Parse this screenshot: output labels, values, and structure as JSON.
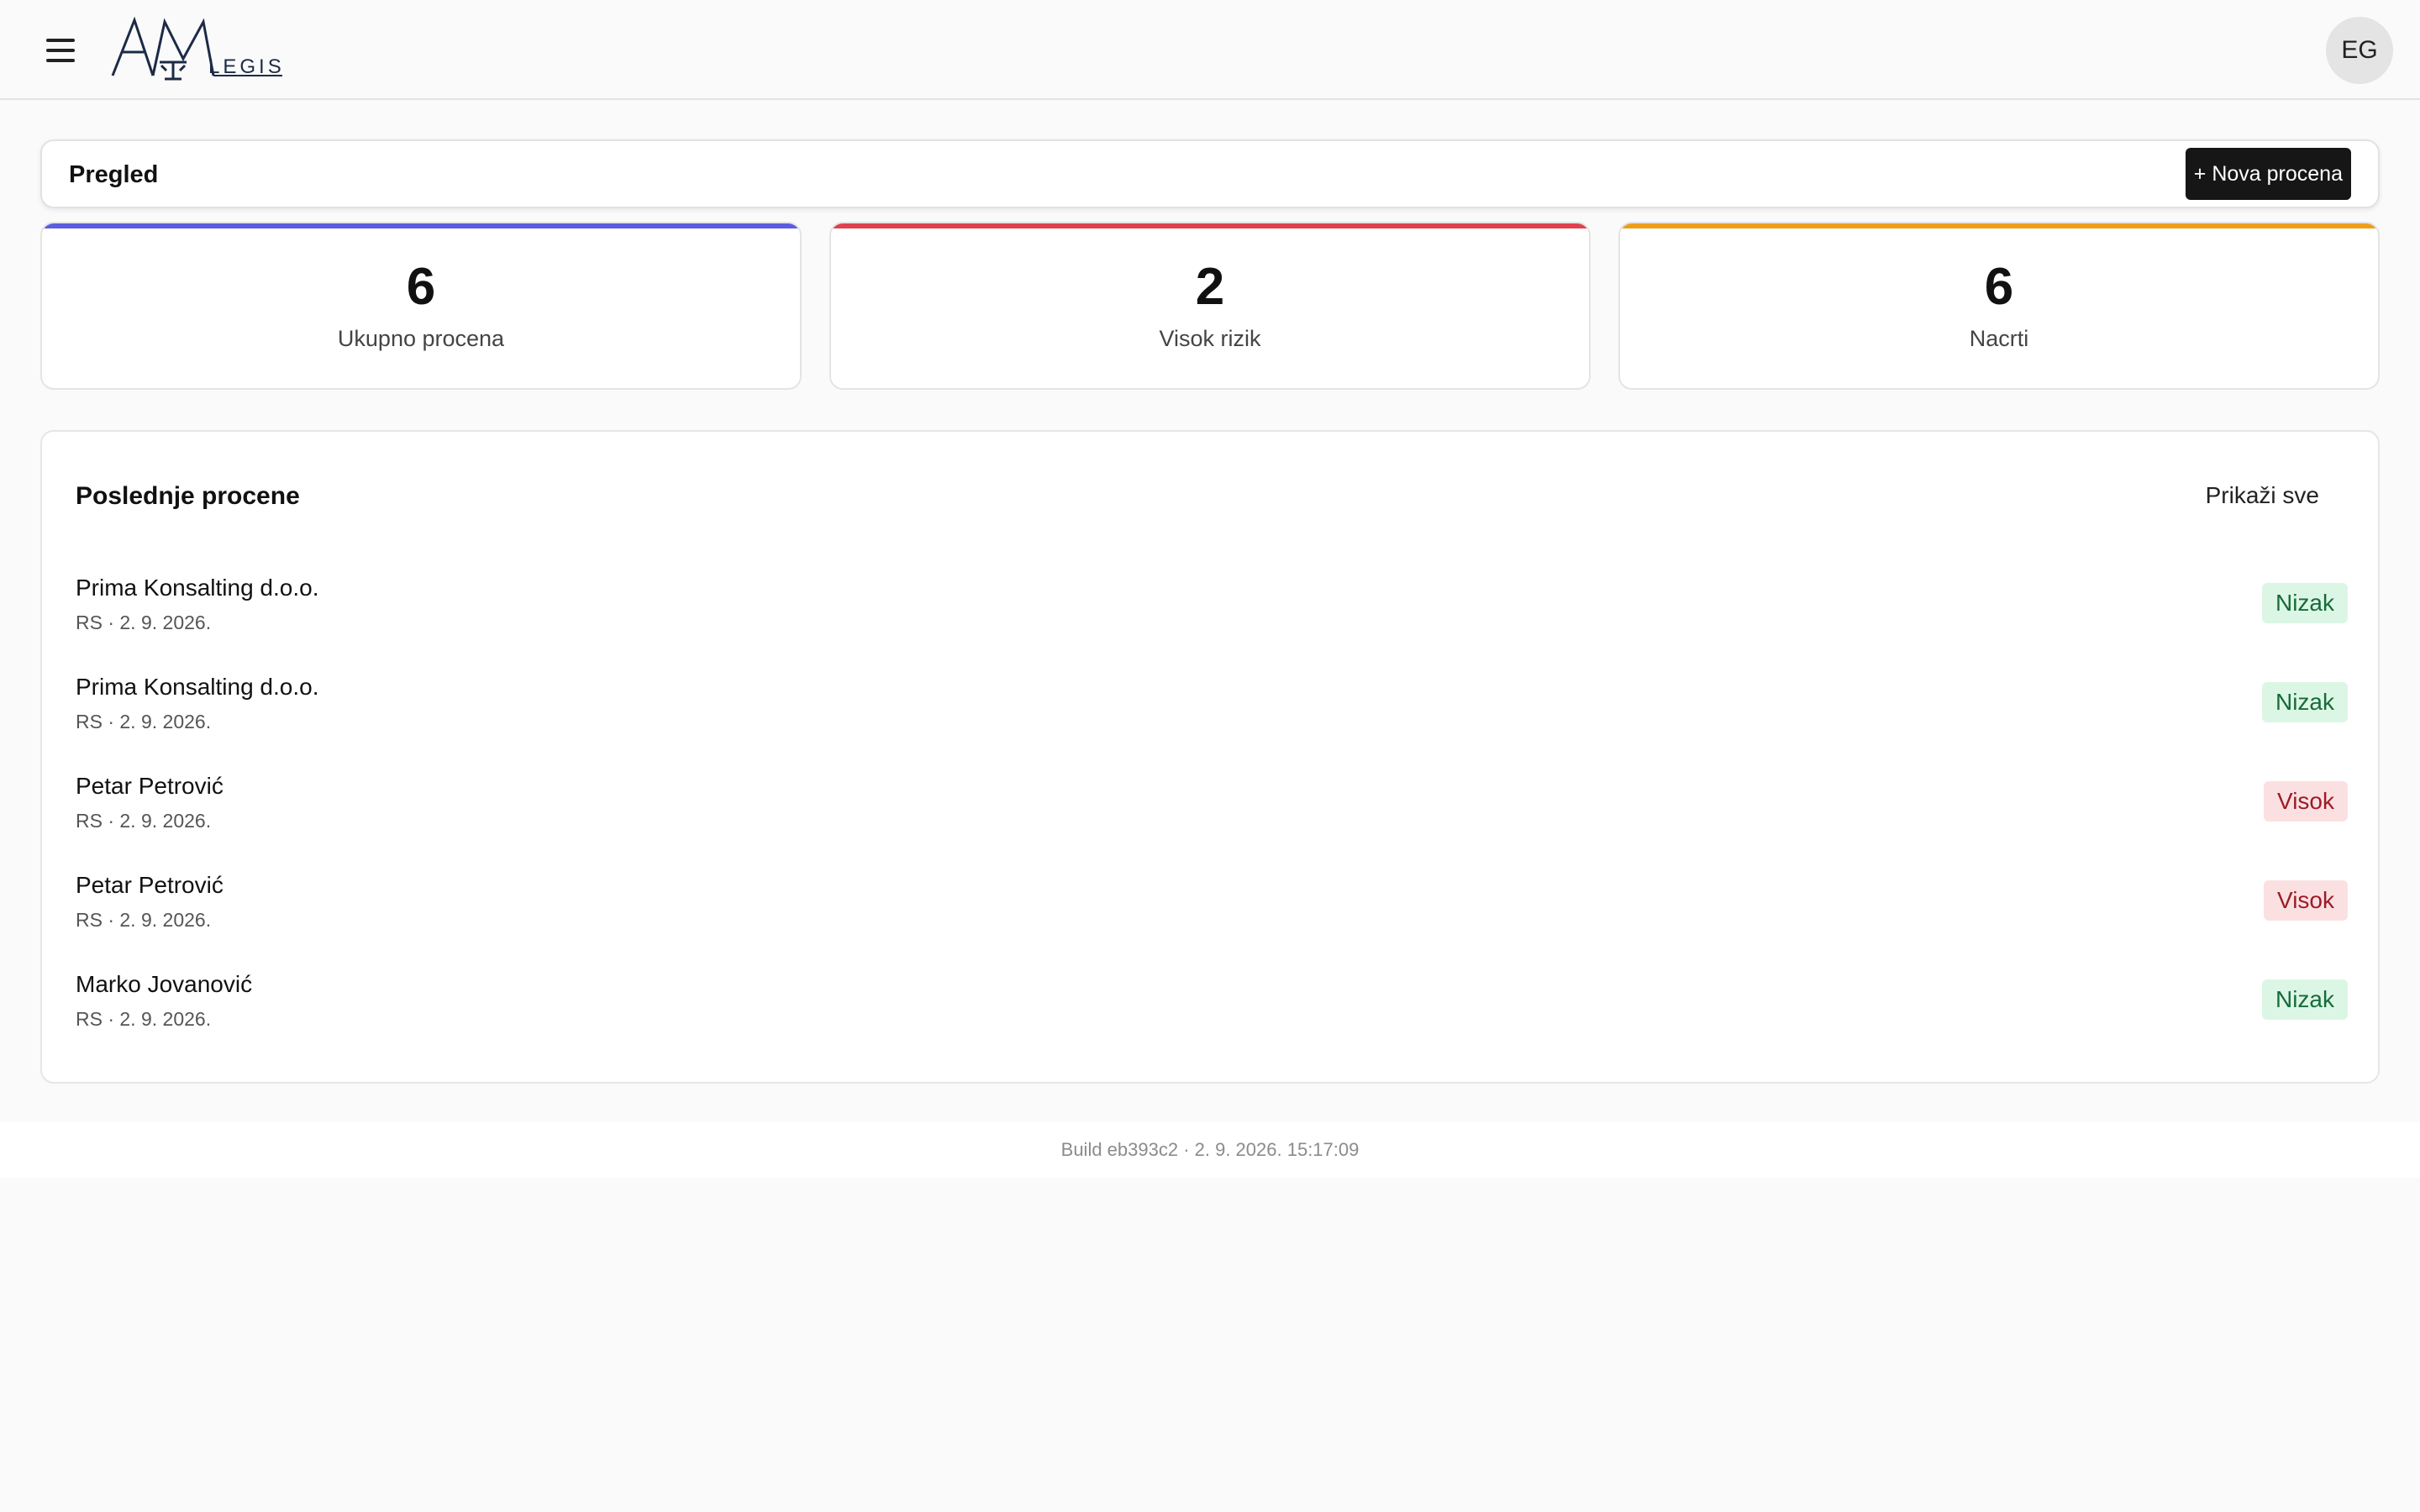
{
  "app": {
    "logo_text": "LEGIS",
    "user_initials": "EG"
  },
  "header": {
    "title": "Pregled",
    "new_button_label": "+ Nova procena"
  },
  "stats": [
    {
      "value": "6",
      "label": "Ukupno procena",
      "accent": "#5b5ce0"
    },
    {
      "value": "2",
      "label": "Visok rizik",
      "accent": "#e0424d"
    },
    {
      "value": "6",
      "label": "Nacrti",
      "accent": "#ef9e1b"
    }
  ],
  "recent": {
    "title": "Poslednje procene",
    "show_all_label": "Prikaži sve",
    "items": [
      {
        "name": "Prima Konsalting d.o.o.",
        "meta": "RS · 2. 9. 2026.",
        "risk": "Nizak",
        "level": "low"
      },
      {
        "name": "Prima Konsalting d.o.o.",
        "meta": "RS · 2. 9. 2026.",
        "risk": "Nizak",
        "level": "low"
      },
      {
        "name": "Petar Petrović",
        "meta": "RS · 2. 9. 2026.",
        "risk": "Visok",
        "level": "high"
      },
      {
        "name": "Petar Petrović",
        "meta": "RS · 2. 9. 2026.",
        "risk": "Visok",
        "level": "high"
      },
      {
        "name": "Marko Jovanović",
        "meta": "RS · 2. 9. 2026.",
        "risk": "Nizak",
        "level": "low"
      }
    ]
  },
  "footer": {
    "build_text": "Build eb393c2 · 2. 9. 2026. 15:17:09"
  }
}
